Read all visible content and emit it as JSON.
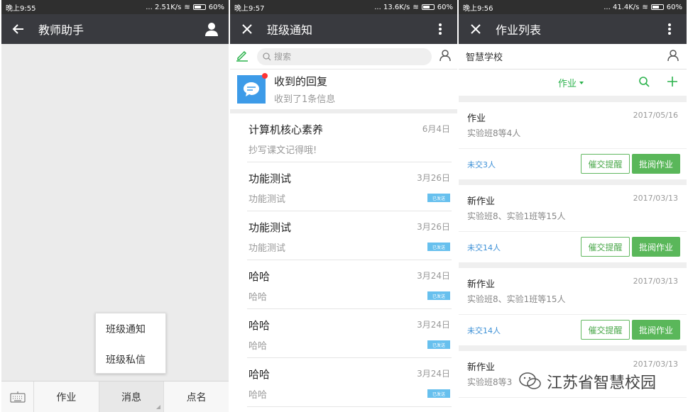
{
  "panels": {
    "teacher": {
      "status": {
        "time": "晚上9:55",
        "speed": "... 2.51K/s",
        "battery": "60%"
      },
      "title": "教师助手",
      "popup": [
        "班级通知",
        "班级私信"
      ],
      "bottom": [
        "作业",
        "消息",
        "点名"
      ]
    },
    "notices": {
      "status": {
        "time": "晚上9:57",
        "speed": "... 13.6K/s",
        "battery": "60%"
      },
      "title": "班级通知",
      "search_placeholder": "搜索",
      "reply": {
        "title": "收到的回复",
        "sub": "收到了1条信息"
      },
      "items": [
        {
          "title": "计算机核心素养",
          "sub": "抄写课文记得哦!",
          "date": "6月4日",
          "badge": ""
        },
        {
          "title": "功能测试",
          "sub": "功能测试",
          "date": "3月26日",
          "badge": "已发送"
        },
        {
          "title": "功能测试",
          "sub": "功能测试",
          "date": "3月26日",
          "badge": "已发送"
        },
        {
          "title": "哈哈",
          "sub": "哈哈",
          "date": "3月24日",
          "badge": "已发送"
        },
        {
          "title": "哈哈",
          "sub": "哈哈",
          "date": "3月24日",
          "badge": "已发送"
        },
        {
          "title": "哈哈",
          "sub": "哈哈",
          "date": "3月24日",
          "badge": "已发送"
        }
      ]
    },
    "homework": {
      "status": {
        "time": "晚上9:56",
        "speed": "... 41.4K/s",
        "battery": "60%"
      },
      "title": "作业列表",
      "school": "智慧学校",
      "filter": "作业",
      "cards": [
        {
          "title": "作业",
          "sub": "实验班8等4人",
          "date": "2017/05/16",
          "pending": "未交3人",
          "remind": "催交提醒",
          "review": "批阅作业"
        },
        {
          "title": "新作业",
          "sub": "实验班8、实验1班等15人",
          "date": "2017/03/13",
          "pending": "未交14人",
          "remind": "催交提醒",
          "review": "批阅作业"
        },
        {
          "title": "新作业",
          "sub": "实验班8、实验1班等15人",
          "date": "2017/03/13",
          "pending": "未交14人",
          "remind": "催交提醒",
          "review": "批阅作业"
        },
        {
          "title": "新作业",
          "sub": "实验班8等3",
          "date": "2017/03/13",
          "pending": "",
          "remind": "",
          "review": ""
        }
      ]
    }
  },
  "watermark": "江苏省智慧校园",
  "colors": {
    "titlebar": "#393a3f",
    "accent_green": "#2bb24c",
    "badge_blue": "#67c0ee"
  }
}
